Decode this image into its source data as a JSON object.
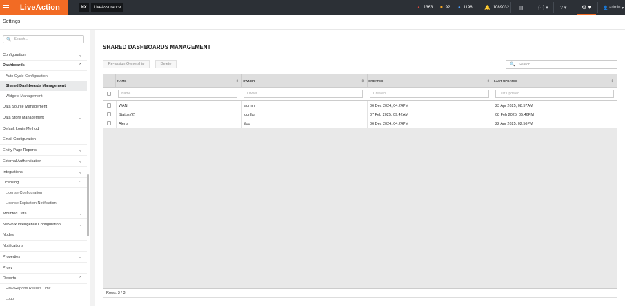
{
  "topbar": {
    "brand": "LiveAction",
    "nx_badge": "NX",
    "product": "LiveAssurance",
    "stats": [
      {
        "icon": "warning-triangle-icon",
        "color": "#e74c3c",
        "value": "1363"
      },
      {
        "icon": "square-icon",
        "color": "#f5a623",
        "value": "92"
      },
      {
        "icon": "circle-icon",
        "color": "#4da3ff",
        "value": "1196"
      },
      {
        "icon": "bell-icon",
        "color": "#4da3ff",
        "value": "1089032"
      }
    ],
    "user": "admin",
    "accent": "#f26b24"
  },
  "page": {
    "title": "Settings"
  },
  "sidebar": {
    "search_placeholder": "Search...",
    "items": [
      {
        "label": "Configuration"
      },
      {
        "label": "Dashboards"
      },
      {
        "label": "Auto Cycle Configuration"
      },
      {
        "label": "Shared Dashboards Management"
      },
      {
        "label": "Widgets Management"
      },
      {
        "label": "Data Source Management"
      },
      {
        "label": "Data Store Management"
      },
      {
        "label": "Default Login Method"
      },
      {
        "label": "Email Configuration"
      },
      {
        "label": "Entity Page Reports"
      },
      {
        "label": "External Authentication"
      },
      {
        "label": "Integrations"
      },
      {
        "label": "Licensing"
      },
      {
        "label": "License Configuration"
      },
      {
        "label": "License Expiration Notification"
      },
      {
        "label": "Mounted Data"
      },
      {
        "label": "Network Intelligence Configuration"
      },
      {
        "label": "Nodes"
      },
      {
        "label": "Notifications"
      },
      {
        "label": "Properties"
      },
      {
        "label": "Proxy"
      },
      {
        "label": "Reports"
      },
      {
        "label": "Flow Reports Results Limit"
      },
      {
        "label": "Logo"
      }
    ]
  },
  "main": {
    "title": "SHARED DASHBOARDS MANAGEMENT",
    "reassign_label": "Re-assign Ownership",
    "delete_label": "Delete",
    "search_placeholder": "Search...",
    "columns": [
      "NAME",
      "OWNER",
      "CREATED",
      "LAST UPDATED"
    ],
    "filters": [
      "Name",
      "Owner",
      "Created",
      "Last Updated"
    ],
    "rows": [
      [
        "WAN",
        "admin",
        "06 Dec 2024, 04:24PM",
        "23 Apr 2025, 08:57AM"
      ],
      [
        "Status (2)",
        "config",
        "07 Feb 2025, 09:42AM",
        "08 Feb 2025, 05:46PM"
      ],
      [
        "Alerts",
        "jloo",
        "06 Dec 2024, 04:24PM",
        "22 Apr 2025, 02:56PM"
      ]
    ],
    "footer": "Rows: 3 / 3"
  }
}
